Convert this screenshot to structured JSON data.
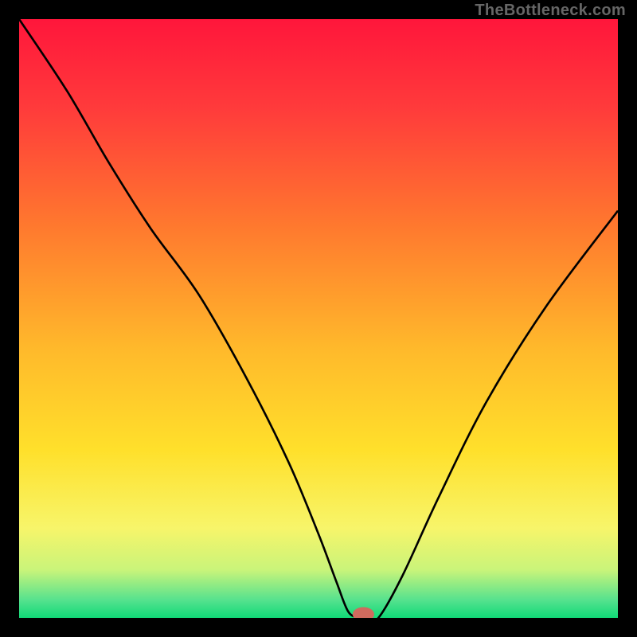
{
  "credit": "TheBottleneck.com",
  "chart_data": {
    "type": "line",
    "title": "",
    "xlabel": "",
    "ylabel": "",
    "xlim": [
      0,
      100
    ],
    "ylim": [
      0,
      100
    ],
    "grid": false,
    "legend": false,
    "series": [
      {
        "name": "bottleneck-curve",
        "x": [
          0,
          8,
          15,
          22,
          30,
          38,
          45,
          50,
          53,
          55,
          57,
          58,
          60,
          64,
          70,
          78,
          88,
          100
        ],
        "y": [
          100,
          88,
          76,
          65,
          54,
          40,
          26,
          14,
          6,
          1,
          0,
          0,
          0,
          7,
          20,
          36,
          52,
          68
        ]
      }
    ],
    "background_gradient": {
      "stops": [
        {
          "offset": 0.0,
          "color": "#ff163b"
        },
        {
          "offset": 0.15,
          "color": "#ff3b3b"
        },
        {
          "offset": 0.35,
          "color": "#ff7a2e"
        },
        {
          "offset": 0.55,
          "color": "#ffb92b"
        },
        {
          "offset": 0.72,
          "color": "#ffe02b"
        },
        {
          "offset": 0.85,
          "color": "#f7f56a"
        },
        {
          "offset": 0.92,
          "color": "#c9f47a"
        },
        {
          "offset": 0.97,
          "color": "#56e28e"
        },
        {
          "offset": 1.0,
          "color": "#10d977"
        }
      ]
    },
    "marker": {
      "x": 57.5,
      "y": 0.6,
      "rx": 1.8,
      "ry": 1.2,
      "color": "#cf6a5e"
    }
  }
}
